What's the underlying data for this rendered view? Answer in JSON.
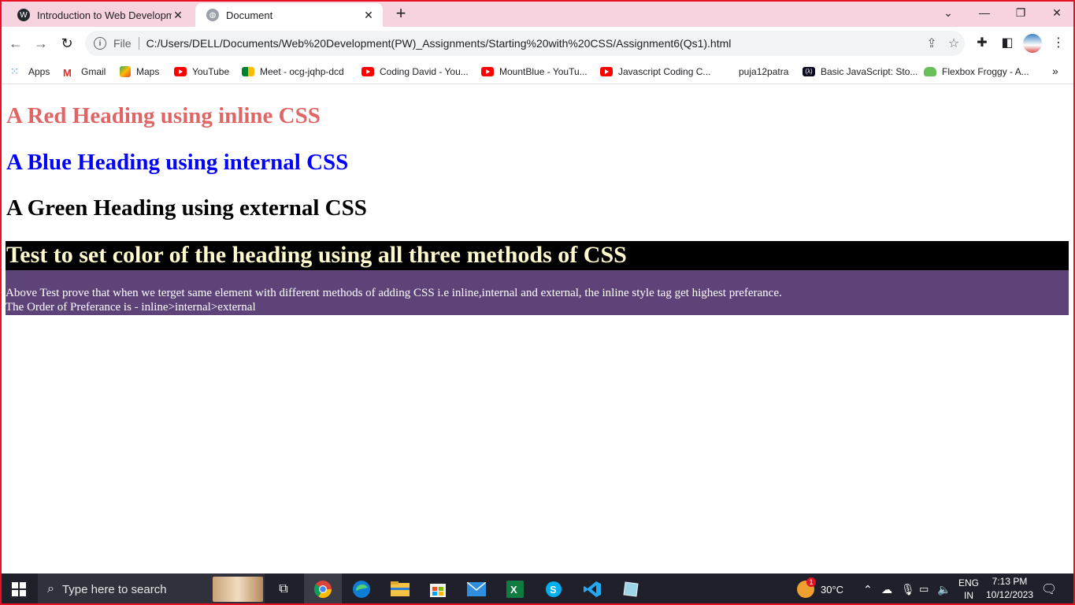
{
  "browser": {
    "tabs": [
      {
        "title": "Introduction to Web Developme",
        "active": false
      },
      {
        "title": "Document",
        "active": true
      }
    ],
    "new_tab_icon": "plus-icon",
    "window_controls": [
      "chevron-down-icon",
      "minimize-icon",
      "restore-icon",
      "close-icon"
    ],
    "address": {
      "scheme_label": "File",
      "url": "C:/Users/DELL/Documents/Web%20Development(PW)_Assignments/Starting%20with%20CSS/Assignment6(Qs1).html"
    },
    "bookmarks": [
      {
        "label": "Apps",
        "icon": "apps-grid-icon"
      },
      {
        "label": "Gmail",
        "icon": "gmail-icon"
      },
      {
        "label": "Maps",
        "icon": "maps-icon"
      },
      {
        "label": "YouTube",
        "icon": "youtube-icon"
      },
      {
        "label": "Meet - ocg-jqhp-dcd",
        "icon": "meet-icon"
      },
      {
        "label": "Coding David - You...",
        "icon": "youtube-icon"
      },
      {
        "label": "MountBlue - YouTu...",
        "icon": "youtube-icon"
      },
      {
        "label": "Javascript Coding C...",
        "icon": "youtube-icon"
      },
      {
        "label": "puja12patra",
        "icon": "none"
      },
      {
        "label": "Basic JavaScript: Sto...",
        "icon": "freecodecamp-icon"
      },
      {
        "label": "Flexbox Froggy - A...",
        "icon": "froggy-icon"
      }
    ]
  },
  "page": {
    "red_heading": "A Red Heading using inline CSS",
    "blue_heading": "A Blue Heading using internal CSS",
    "green_heading": "A Green Heading using external CSS",
    "test_heading": "Test to set color of the heading using all three methods of CSS",
    "note_line1": "Above Test prove that when we terget same element with different methods of adding CSS i.e inline,internal and external, the inline style tag get highest preferance.",
    "note_line2": "The Order of Preferance is - inline>internal>external",
    "colors": {
      "red": "#e06666",
      "blue": "#0000ff",
      "test_bg": "#000000",
      "test_fg": "#fffacd",
      "note_bg": "#5e4379"
    }
  },
  "taskbar": {
    "search_placeholder": "Type here to search",
    "weather": "30°C",
    "weather_badge": "1",
    "lang_top": "ENG",
    "lang_bottom": "IN",
    "time": "7:13 PM",
    "date": "10/12/2023"
  }
}
